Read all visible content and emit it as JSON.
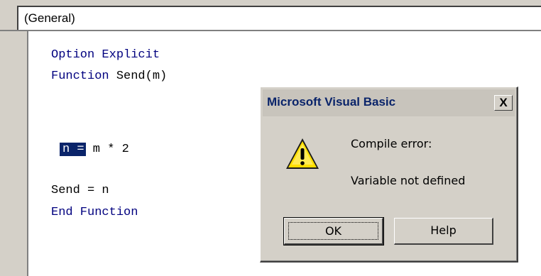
{
  "combo": {
    "value": "(General)"
  },
  "code": {
    "line1": "Option Explicit",
    "line2_kw": "Function",
    "line2_rest": " Send(m)",
    "line3_sel": "n =",
    "line3_rest": " m * 2",
    "line4": "Send = n",
    "line5_kw": "End Function"
  },
  "dialog": {
    "title": "Microsoft Visual Basic",
    "close_glyph": "X",
    "icon": "warning-icon",
    "message1": "Compile error:",
    "message2": "Variable not defined",
    "ok_label": "OK",
    "help_label": "Help"
  }
}
